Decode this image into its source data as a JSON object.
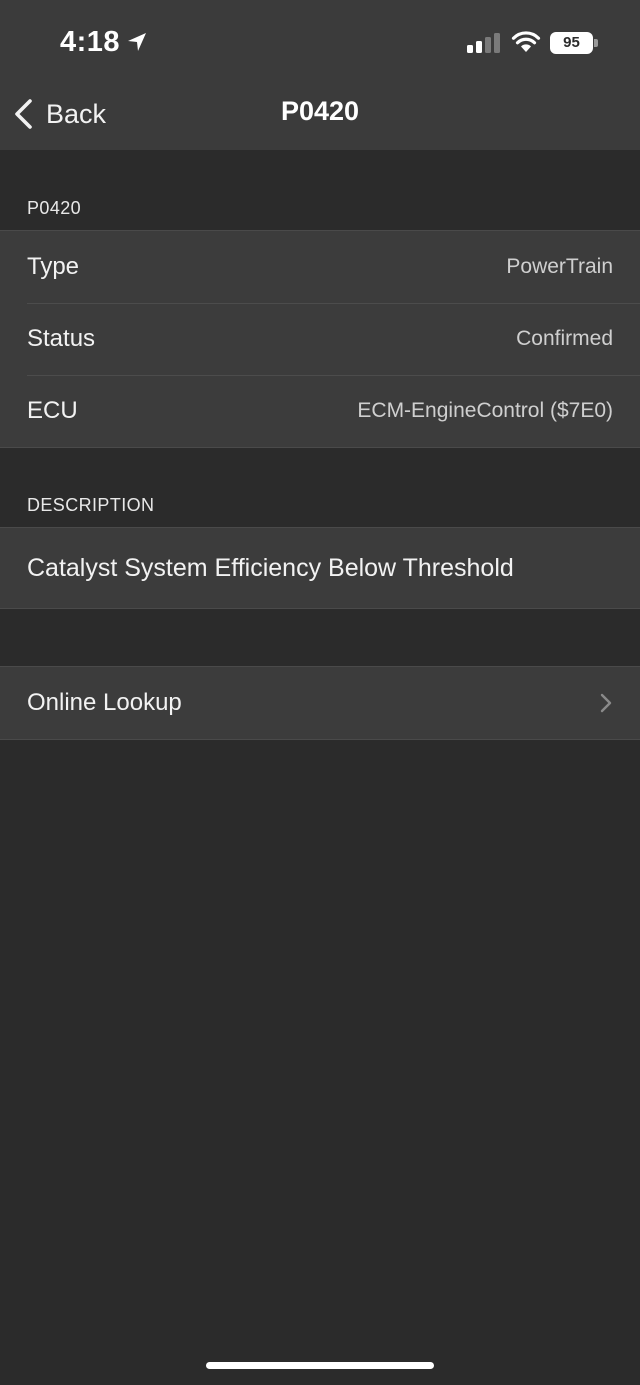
{
  "status_bar": {
    "time": "4:18",
    "battery": "95",
    "icons": [
      "location-arrow-icon",
      "signal-icon",
      "wifi-icon",
      "battery-icon"
    ]
  },
  "nav": {
    "back_label": "Back",
    "title": "P0420"
  },
  "info_section": {
    "header": "P0420",
    "rows": [
      {
        "label": "Type",
        "value": "PowerTrain"
      },
      {
        "label": "Status",
        "value": "Confirmed"
      },
      {
        "label": "ECU",
        "value": "ECM-EngineControl ($7E0)"
      }
    ]
  },
  "description_section": {
    "header": "DESCRIPTION",
    "text": "Catalyst System Efficiency Below Threshold"
  },
  "actions": {
    "online_lookup": "Online Lookup"
  },
  "colors": {
    "background": "#2b2b2b",
    "nav_bar": "#3b3b3b",
    "cell": "#3c3c3c",
    "text": "#f2f2f2",
    "secondary_text": "#cfcfcf"
  }
}
